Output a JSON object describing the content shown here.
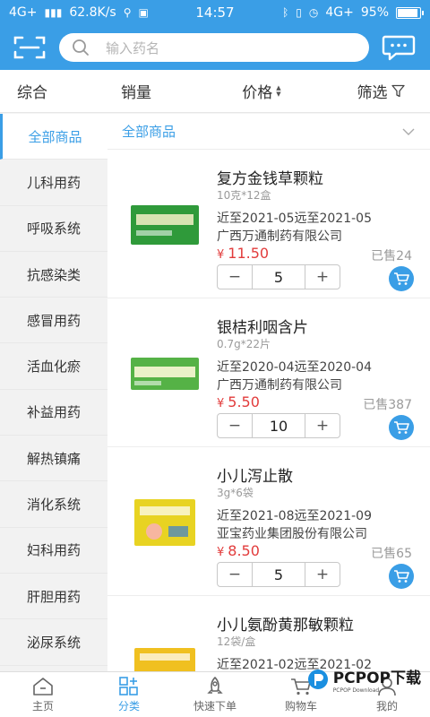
{
  "status_bar": {
    "network": "4G+",
    "speed": "62.8K/s",
    "time": "14:57",
    "network_right": "4G+",
    "battery_text": "95%",
    "battery_level": 0.95
  },
  "header": {
    "search_placeholder": "输入药名"
  },
  "filters": {
    "comprehensive": "综合",
    "sales": "销量",
    "price": "价格",
    "filter": "筛选"
  },
  "sidebar": {
    "items": [
      {
        "label": "全部商品",
        "active": true
      },
      {
        "label": "儿科用药"
      },
      {
        "label": "呼吸系统"
      },
      {
        "label": "抗感染类"
      },
      {
        "label": "感冒用药"
      },
      {
        "label": "活血化瘀"
      },
      {
        "label": "补益用药"
      },
      {
        "label": "解热镇痛"
      },
      {
        "label": "消化系统"
      },
      {
        "label": "妇科用药"
      },
      {
        "label": "肝胆用药"
      },
      {
        "label": "泌尿系统"
      }
    ]
  },
  "content": {
    "category_title": "全部商品",
    "currency": "¥",
    "products": [
      {
        "name": "复方金钱草颗粒",
        "spec": "10克*12盒",
        "date": "近至2021-05远至2021-05",
        "maker": "广西万通制药有限公司",
        "price": "11.50",
        "sold": "已售24",
        "qty": "5",
        "box_color": "#2f9a3a"
      },
      {
        "name": "银桔利咽含片",
        "spec": "0.7g*22片",
        "date": "近至2020-04远至2020-04",
        "maker": "广西万通制药有限公司",
        "price": "5.50",
        "sold": "已售387",
        "qty": "10",
        "box_color": "#55b246"
      },
      {
        "name": "小儿泻止散",
        "spec": "3g*6袋",
        "date": "近至2021-08远至2021-09",
        "maker": "亚宝药业集团股份有限公司",
        "price": "8.50",
        "sold": "已售65",
        "qty": "5",
        "box_color": "#e8d322"
      },
      {
        "name": "小儿氨酚黄那敏颗粒",
        "spec": "12袋/盒",
        "date": "近至2021-02远至2021-02",
        "maker": "",
        "price": "",
        "sold": "",
        "qty": "",
        "box_color": "#f0c020"
      }
    ]
  },
  "bottom_nav": [
    {
      "label": "主页",
      "icon": "home-icon"
    },
    {
      "label": "分类",
      "icon": "category-icon",
      "active": true
    },
    {
      "label": "快速下单",
      "icon": "rocket-icon"
    },
    {
      "label": "购物车",
      "icon": "cart-icon"
    },
    {
      "label": "我的",
      "icon": "profile-icon"
    }
  ],
  "watermark": {
    "text": "PCPOP下载",
    "sub": "PCPOP Download"
  },
  "colors": {
    "accent": "#3a9ee6",
    "price": "#e23c3c"
  }
}
